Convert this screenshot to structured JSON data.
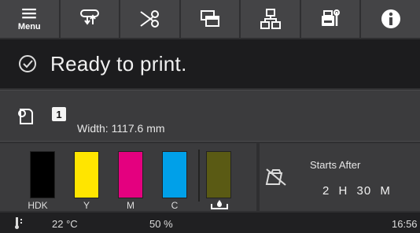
{
  "toolbar": {
    "menu_label": "Menu",
    "buttons": [
      {
        "icon": "menu-icon"
      },
      {
        "icon": "media-feed-icon"
      },
      {
        "icon": "cutter-icon"
      },
      {
        "icon": "layers-icon"
      },
      {
        "icon": "network-icon"
      },
      {
        "icon": "printer-maintenance-icon"
      },
      {
        "icon": "info-icon"
      }
    ]
  },
  "status": {
    "icon": "check-circle-icon",
    "text": "Ready to print."
  },
  "media": {
    "icon": "roll-media-icon",
    "tray_number": "1",
    "width_text": "Width: 1117.6 mm"
  },
  "inks": [
    {
      "label": "HDK",
      "color": "#000000",
      "level": 1.0
    },
    {
      "label": "Y",
      "color": "#ffe500",
      "level": 1.0
    },
    {
      "label": "M",
      "color": "#e4007f",
      "level": 1.0
    },
    {
      "label": "C",
      "color": "#00a0e9",
      "level": 1.0
    },
    {
      "label": "",
      "color": "#5a5a14",
      "level": 1.0,
      "icon": "maintenance-box-icon"
    }
  ],
  "timer": {
    "icon": "no-print-timer-icon",
    "label": "Starts After",
    "value": "2 H  30 M"
  },
  "footer": {
    "temperature": "22 °C",
    "humidity": "50 %",
    "time": "16:56",
    "icon": "temperature-icon"
  }
}
